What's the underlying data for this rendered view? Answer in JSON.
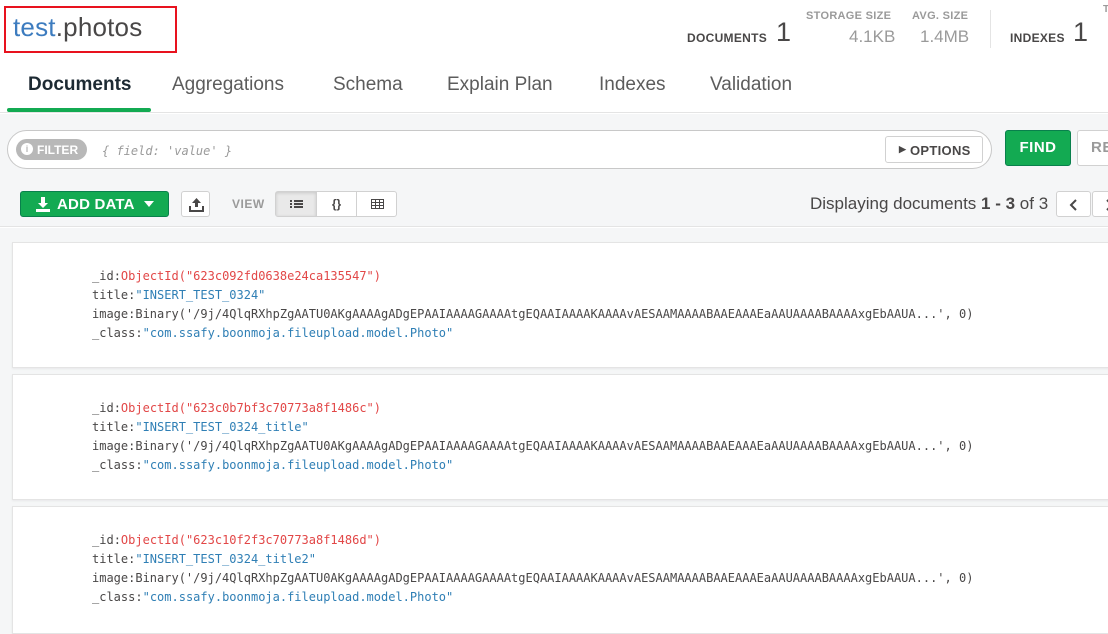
{
  "header": {
    "db": "test",
    "dot": ".",
    "collection": "photos",
    "documents_label": "DOCUMENTS",
    "documents_count": "1",
    "storage_label": "STORAGE SIZE",
    "storage_value": "4.1KB",
    "avg_label": "AVG. SIZE",
    "avg_value": "1.4MB",
    "indexes_label": "INDEXES",
    "indexes_count": "1",
    "more_label": "T"
  },
  "tabs": [
    {
      "label": "Documents",
      "active": true
    },
    {
      "label": "Aggregations"
    },
    {
      "label": "Schema"
    },
    {
      "label": "Explain Plan"
    },
    {
      "label": "Indexes"
    },
    {
      "label": "Validation"
    }
  ],
  "query": {
    "filter_label": "FILTER",
    "filter_placeholder": "{ field: 'value' }",
    "options_label": "OPTIONS",
    "find_label": "FIND",
    "reset_label": "RE"
  },
  "toolbar": {
    "add_data_label": "ADD DATA",
    "view_label": "VIEW",
    "display_prefix": "Displaying documents ",
    "display_range": "1 - 3",
    "display_of": " of ",
    "display_total": "3"
  },
  "documents": [
    {
      "id_key": "_id",
      "id_value": "ObjectId(\"623c092fd0638e24ca135547\")",
      "title_key": "title",
      "title_value": "\"INSERT_TEST_0324\"",
      "image_key": "image",
      "image_value": "Binary('/9j/4QlqRXhpZgAATU0AKgAAAAgADgEPAAIAAAAGAAAAtgEQAAIAAAAKAAAAvAESAAMAAAABAAEAAAEaAAUAAAABAAAAxgEbAAUA...', 0)",
      "class_key": "_class",
      "class_value": "\"com.ssafy.boonmoja.fileupload.model.Photo\""
    },
    {
      "id_key": "_id",
      "id_value": "ObjectId(\"623c0b7bf3c70773a8f1486c\")",
      "title_key": "title",
      "title_value": "\"INSERT_TEST_0324_title\"",
      "image_key": "image",
      "image_value": "Binary('/9j/4QlqRXhpZgAATU0AKgAAAAgADgEPAAIAAAAGAAAAtgEQAAIAAAAKAAAAvAESAAMAAAABAAEAAAEaAAUAAAABAAAAxgEbAAUA...', 0)",
      "class_key": "_class",
      "class_value": "\"com.ssafy.boonmoja.fileupload.model.Photo\""
    },
    {
      "id_key": "_id",
      "id_value": "ObjectId(\"623c10f2f3c70773a8f1486d\")",
      "title_key": "title",
      "title_value": "\"INSERT_TEST_0324_title2\"",
      "image_key": "image",
      "image_value": "Binary('/9j/4QlqRXhpZgAATU0AKgAAAAgADgEPAAIAAAAGAAAAtgEQAAIAAAAKAAAAvAESAAMAAAABAAEAAAEaAAUAAAABAAAAxgEbAAUA...', 0)",
      "class_key": "_class",
      "class_value": "\"com.ssafy.boonmoja.fileupload.model.Photo\""
    }
  ],
  "colors": {
    "accent_green": "#13aa52",
    "namespace_db": "#3d7cbf",
    "highlight_box": "#e8121e",
    "objectid_red": "#e24747",
    "string_blue": "#2f7fb5"
  }
}
